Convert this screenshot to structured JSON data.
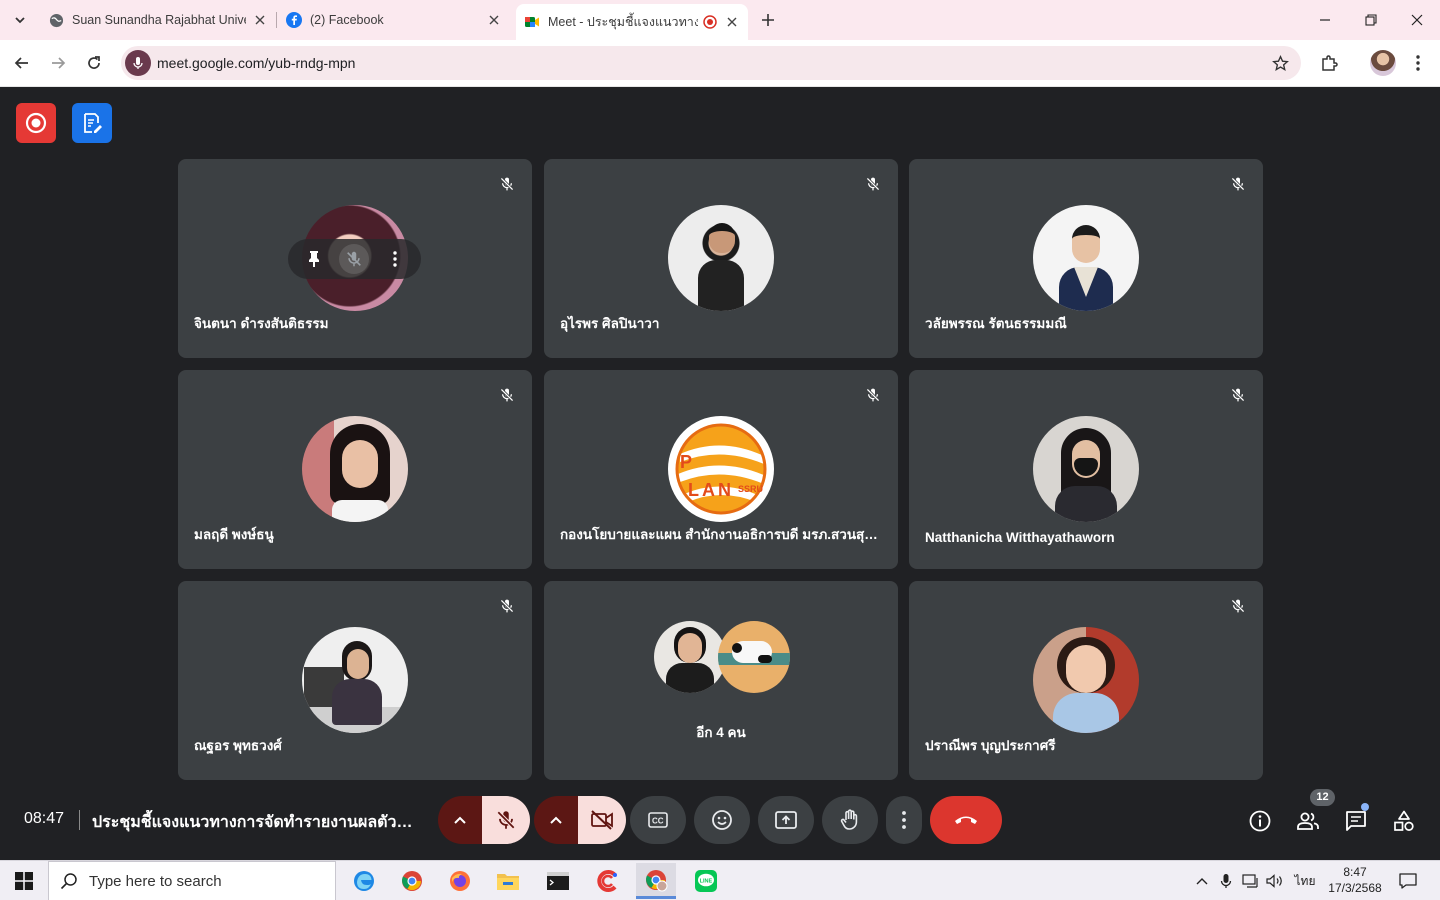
{
  "browser": {
    "tabs": [
      {
        "title": "Suan Sunandha Rajabhat Unive",
        "icon": "globe-icon"
      },
      {
        "title": "(2) Facebook",
        "icon": "facebook-icon"
      },
      {
        "title": "Meet - ประชุมชี้แจงแนวทางการ",
        "icon": "meet-icon",
        "active": true
      }
    ],
    "url": "meet.google.com/yub-rndg-mpn"
  },
  "tiles": [
    {
      "name": "จินตนา ดำรงสันติธรรม",
      "muted": true
    },
    {
      "name": "อุไรพร ศิลปินาวา",
      "muted": true
    },
    {
      "name": "วลัยพรรณ รัตนธรรมมณี",
      "muted": true
    },
    {
      "name": "มลฤดี พงษ์ธนู",
      "muted": true
    },
    {
      "name": "กองนโยบายและแผน สำนักงานอธิการบดี มรภ.สวนสุน...",
      "muted": true
    },
    {
      "name": "Natthanicha Witthayathaworn",
      "muted": true
    },
    {
      "name": "ณฐอร พุทธวงศ์",
      "muted": true
    },
    {
      "name": "อีก 4 คน"
    },
    {
      "name": "ปราณีพร บุญประกาศรี",
      "muted": true
    }
  ],
  "logo_text": {
    "top": "P",
    "main": "LAN",
    "sub": "SSRU"
  },
  "meeting": {
    "time": "08:47",
    "title": "ประชุมชี้แจงแนวทางการจัดทำรายงานผลตัวชี้วัดต...",
    "participant_count": "12"
  },
  "taskbar": {
    "search_placeholder": "Type here to search",
    "language": "ไทย",
    "time": "8:47",
    "date": "17/3/2568"
  },
  "colors": {
    "meet_background": "#202124",
    "tile": "#3c4043",
    "leave_red": "#dc362e",
    "mic_off_bg": "#f9dedc",
    "record_red": "#e53935",
    "notes_blue": "#1a73e8"
  }
}
